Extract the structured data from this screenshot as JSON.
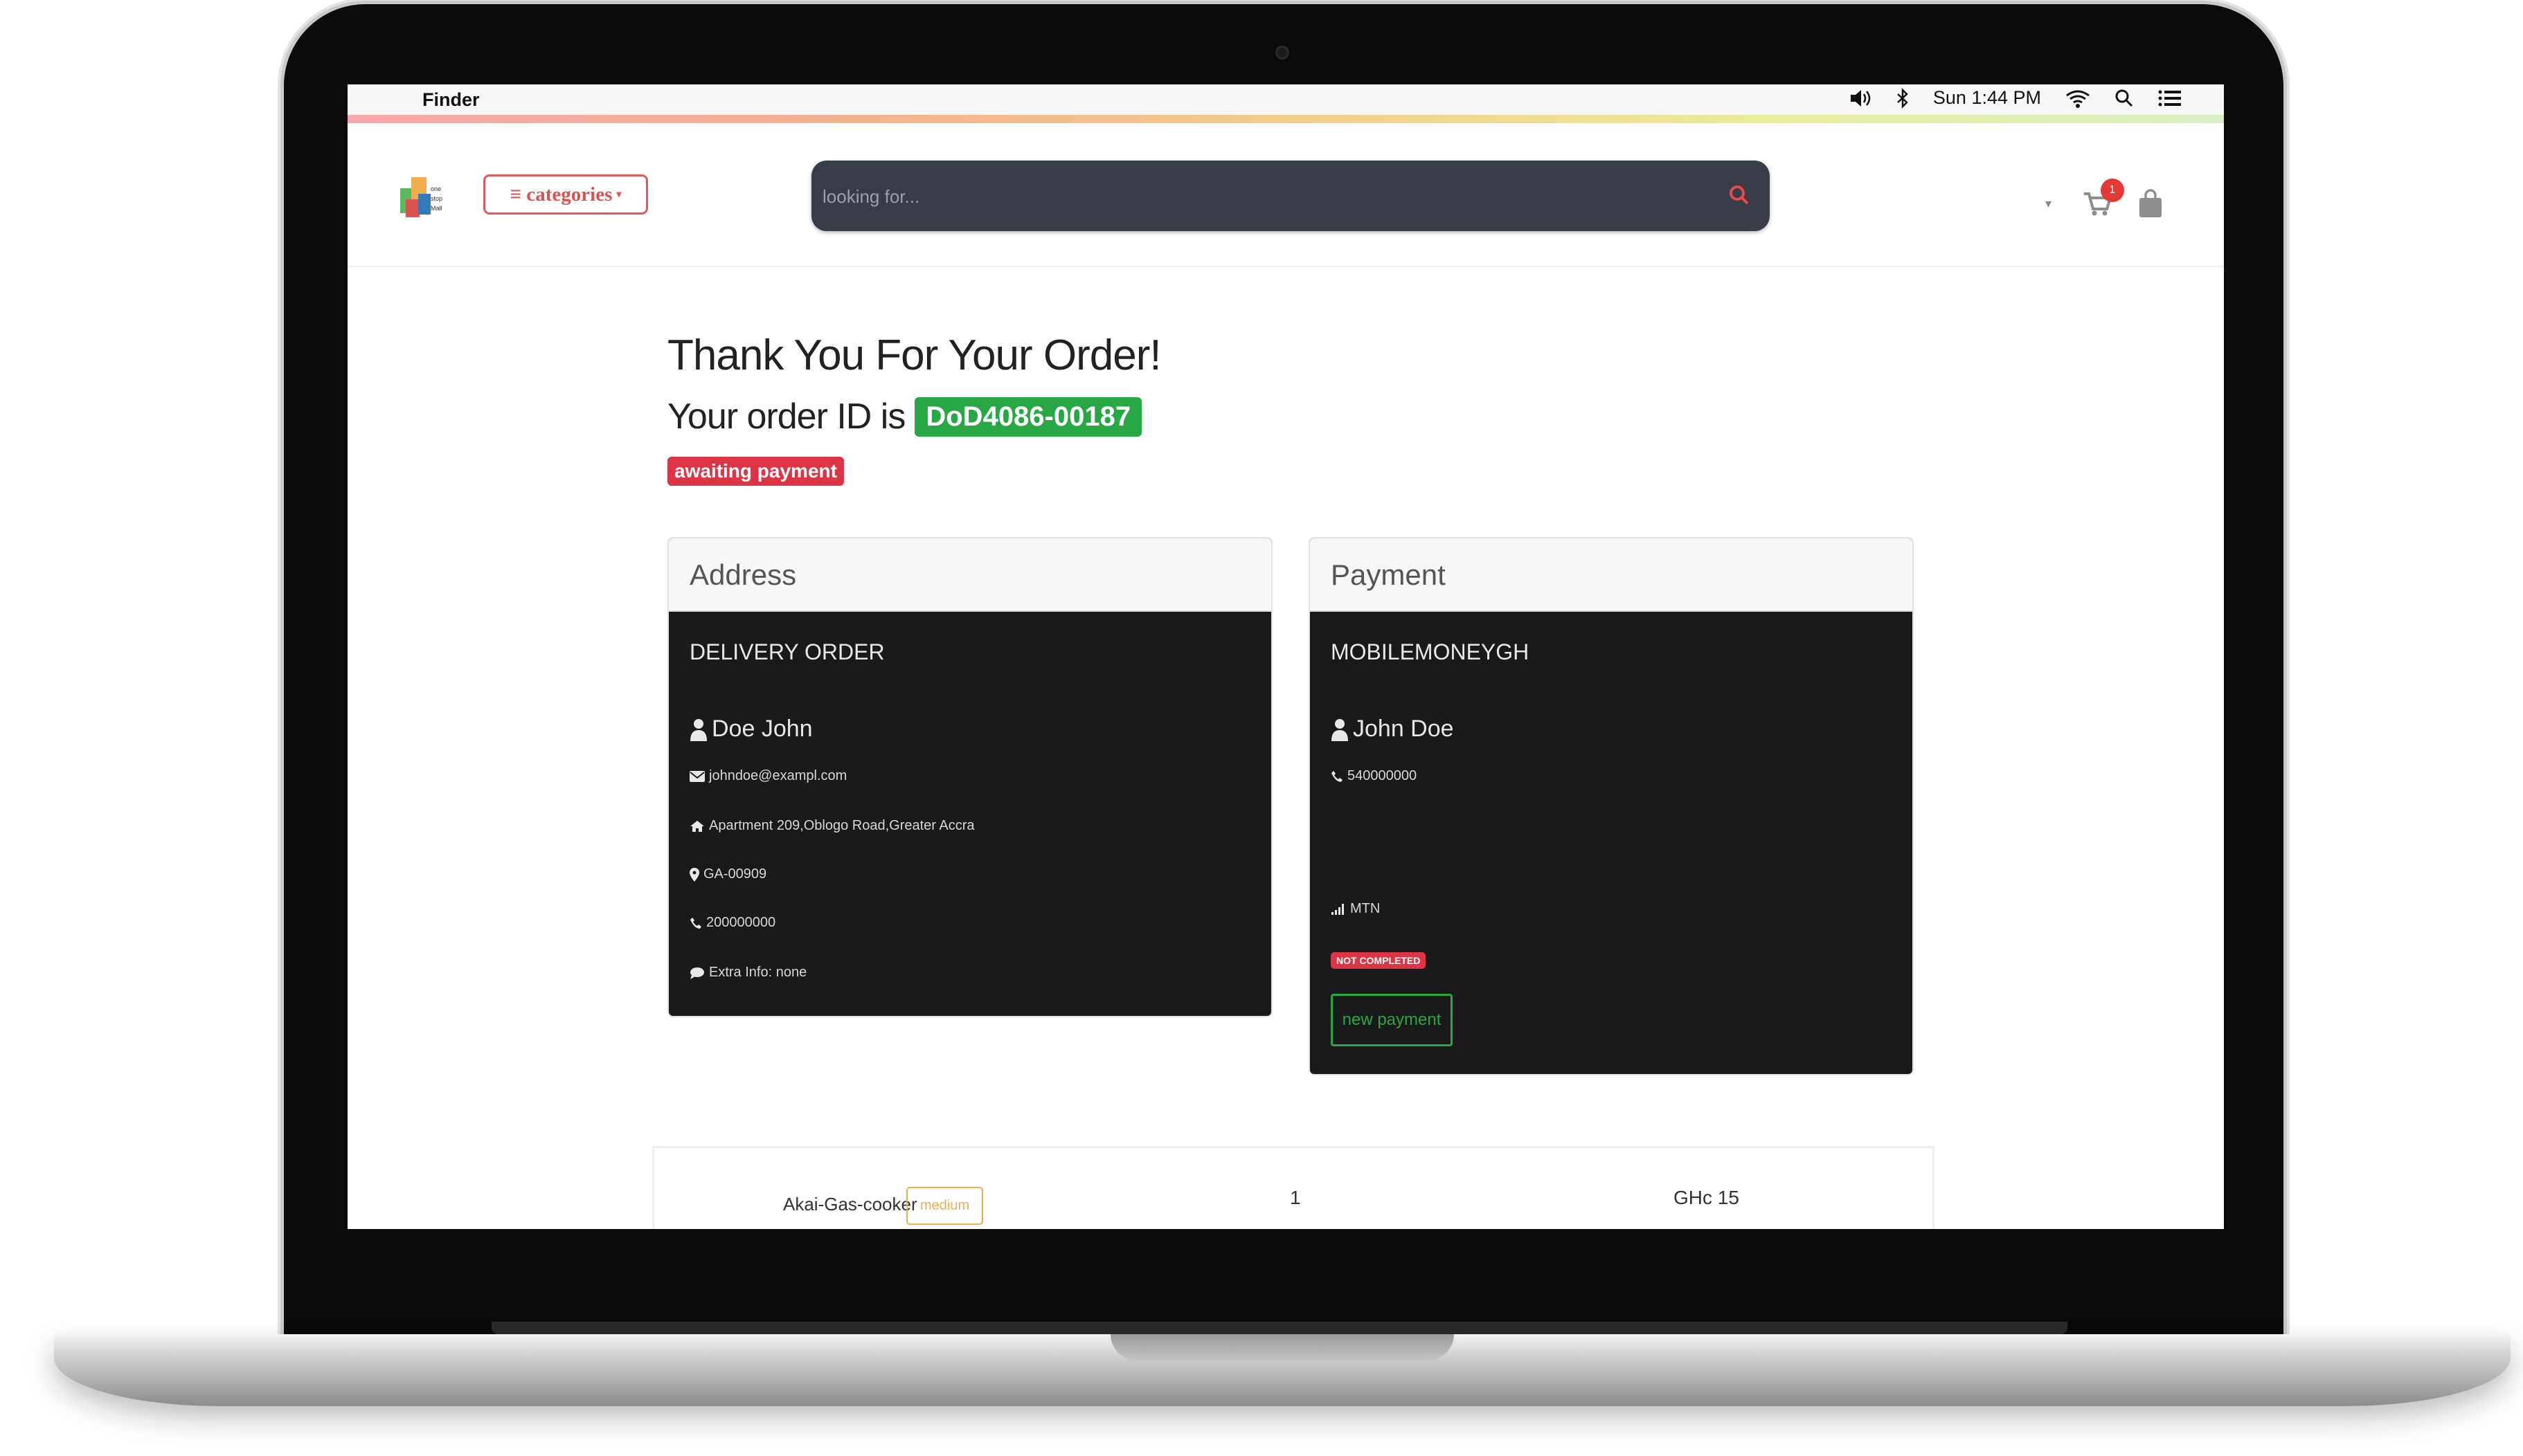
{
  "menubar": {
    "app_name": "Finder",
    "clock": "Sun 1:44 PM"
  },
  "header": {
    "categories_label": "≡ categories",
    "search_placeholder": "looking for...",
    "cart_count": "1"
  },
  "confirmation": {
    "title": "Thank You For Your Order!",
    "order_prefix": "Your order ID is",
    "order_id": "DoD4086-00187",
    "status": "awaiting payment"
  },
  "address_card": {
    "heading": "Address",
    "type": "DELIVERY ORDER",
    "name": "Doe John",
    "email": "johndoe@exampl.com",
    "street": "Apartment 209,Oblogo Road,Greater Accra",
    "postal": "GA-00909",
    "phone": "200000000",
    "extra": "Extra Info: none"
  },
  "payment_card": {
    "heading": "Payment",
    "method": "MOBILEMONEYGH",
    "name": "John Doe",
    "phone": "540000000",
    "network": "MTN",
    "status": "NOT COMPLETED",
    "new_payment_label": "new payment"
  },
  "order_items": [
    {
      "name": "Akai-Gas-cooker",
      "size": "medium",
      "quantity": "1",
      "price": "GHc 15"
    }
  ],
  "colors": {
    "success": "#28a745",
    "danger": "#dc3545",
    "warning": "#f0ad4e",
    "search_bg": "#383d48",
    "card_body": "#1a1a1a"
  }
}
